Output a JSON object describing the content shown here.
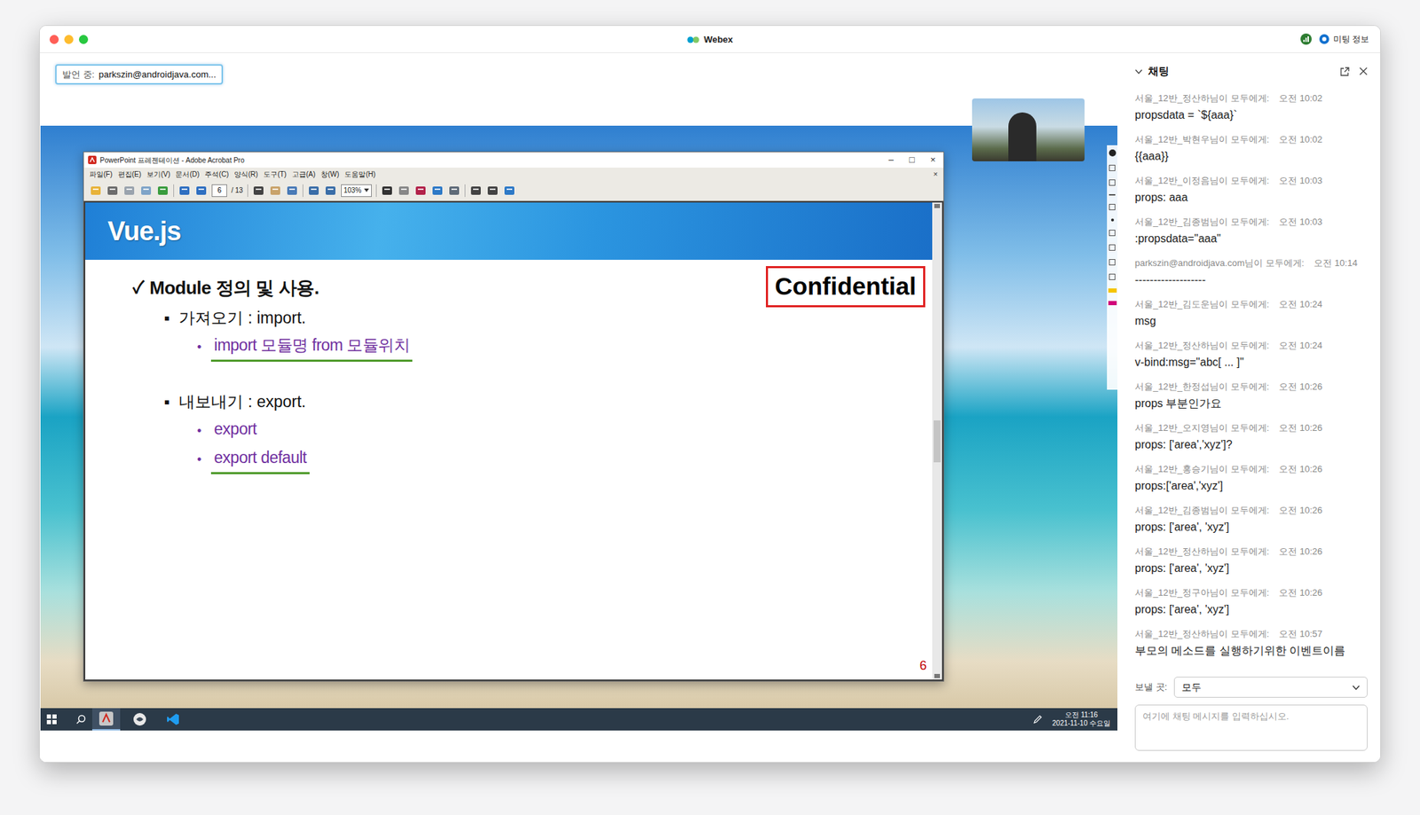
{
  "window": {
    "title": "Webex",
    "meeting_info": "미팅 정보"
  },
  "speaker": {
    "label": "발언 중:",
    "name": "parkszin@androidjava.com..."
  },
  "acrobat": {
    "title": "PowerPoint 프레젠테이션 - Adobe Acrobat Pro",
    "controls": [
      "–",
      "□",
      "×"
    ],
    "menu": [
      "파일(F)",
      "편집(E)",
      "보기(V)",
      "문서(D)",
      "주석(C)",
      "양식(R)",
      "도구(T)",
      "고급(A)",
      "창(W)",
      "도움말(H)"
    ],
    "menu_close": "×",
    "page": "6",
    "page_total": "/ 13",
    "zoom": "103%",
    "slide": {
      "title": "Vue.js",
      "badge": "Confidential",
      "heading_mark": "✓",
      "heading": "Module 정의 및 사용.",
      "sections": [
        {
          "bullet": "■",
          "label": "가져오기 : import.",
          "items": [
            {
              "bullet": "•",
              "text": "import 모듈명 from 모듈위치",
              "underlined": true
            }
          ]
        },
        {
          "bullet": "■",
          "label": "내보내기 : export.",
          "items": [
            {
              "bullet": "•",
              "text": "export",
              "underlined": false
            },
            {
              "bullet": "•",
              "text": "export default",
              "underlined": true
            }
          ]
        }
      ],
      "page_number": "6"
    }
  },
  "taskbar": {
    "time": "오전 11:16",
    "date": "2021-11-10 수요일"
  },
  "chat": {
    "title": "채팅",
    "messages": [
      {
        "sender": "서울_12반_정산하님이 모두에게:",
        "time": "오전 10:02",
        "text": "propsdata = `${aaa}`"
      },
      {
        "sender": "서울_12반_박현우님이 모두에게:",
        "time": "오전 10:02",
        "text": "{{aaa}}"
      },
      {
        "sender": "서울_12반_이정음님이 모두에게:",
        "time": "오전 10:03",
        "text": "props: aaa"
      },
      {
        "sender": "서울_12반_김종범님이 모두에게:",
        "time": "오전 10:03",
        "text": ":propsdata=\"aaa\""
      },
      {
        "sender": "parkszin@androidjava.com님이 모두에게:",
        "time": "오전 10:14",
        "text": "-------------------"
      },
      {
        "sender": "서울_12반_김도운님이 모두에게:",
        "time": "오전 10:24",
        "text": "msg"
      },
      {
        "sender": "서울_12반_정산하님이 모두에게:",
        "time": "오전 10:24",
        "text": "v-bind:msg=\"abc[ ... ]\""
      },
      {
        "sender": "서울_12반_한정섭님이 모두에게:",
        "time": "오전 10:26",
        "text": "props 부분인가요"
      },
      {
        "sender": "서울_12반_오지영님이 모두에게:",
        "time": "오전 10:26",
        "text": "props: ['area','xyz']?"
      },
      {
        "sender": "서울_12반_홍승기님이 모두에게:",
        "time": "오전 10:26",
        "text": "props:['area','xyz']"
      },
      {
        "sender": "서울_12반_김종범님이 모두에게:",
        "time": "오전 10:26",
        "text": "props: ['area', 'xyz']"
      },
      {
        "sender": "서울_12반_정산하님이 모두에게:",
        "time": "오전 10:26",
        "text": "props: ['area', 'xyz']"
      },
      {
        "sender": "서울_12반_정구아님이 모두에게:",
        "time": "오전 10:26",
        "text": "props: ['area', 'xyz']"
      },
      {
        "sender": "서울_12반_정산하님이 모두에게:",
        "time": "오전 10:57",
        "text": "부모의 메소드를 실행하기위한 이벤트이름"
      }
    ],
    "send_to_label": "보낼 곳:",
    "send_to": "모두",
    "placeholder": "여기에 채팅 메시지를 입력하십시오."
  }
}
